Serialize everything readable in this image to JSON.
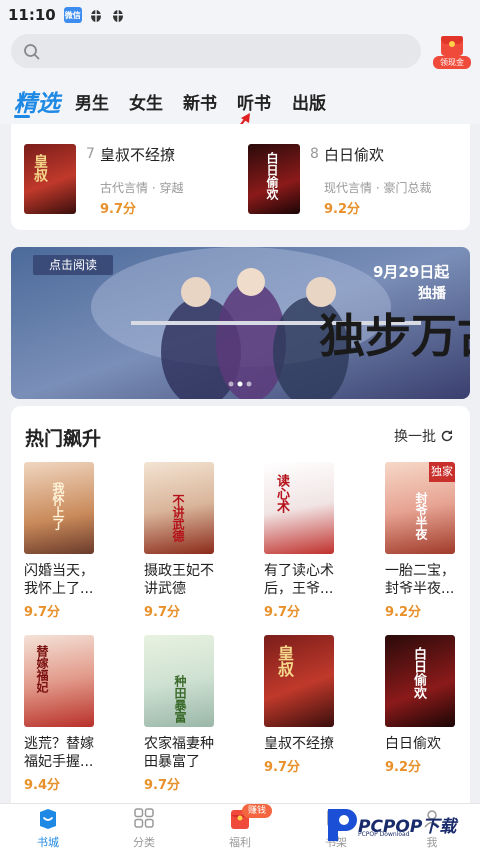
{
  "status_bar": {
    "time": "11:10",
    "app_icon_text": "微信"
  },
  "search": {
    "placeholder": ""
  },
  "redpacket": {
    "label": "领现金"
  },
  "tabs": [
    {
      "label": "精选"
    },
    {
      "label": "男生"
    },
    {
      "label": "女生"
    },
    {
      "label": "新书"
    },
    {
      "label": "听书"
    },
    {
      "label": "出版"
    }
  ],
  "ranking": [
    {
      "num": "7",
      "title": "皇叔不经撩",
      "tags": "古代言情 · 穿越",
      "score": "9.7分",
      "cover_text": "皇叔"
    },
    {
      "num": "8",
      "title": "白日偷欢",
      "tags": "现代言情 · 豪门总裁",
      "score": "9.2分",
      "cover_text": "白日偷欢"
    }
  ],
  "banner": {
    "button": "点击阅读",
    "date": "9月29日起",
    "exclusive": "独播",
    "calligraphy": "独步万古"
  },
  "hot": {
    "title": "热门飙升",
    "refresh": "换一批",
    "books": [
      {
        "name": "闪婚当天，我怀上了...",
        "score": "9.7分",
        "cover_text": "我怀上了"
      },
      {
        "name": "摄政王妃不讲武德",
        "score": "9.7分",
        "cover_text": "不讲武德"
      },
      {
        "name": "有了读心术后，王爷...",
        "score": "9.7分",
        "cover_text": "读心术"
      },
      {
        "name": "一胎二宝，封爷半夜...",
        "score": "9.2分",
        "cover_text": "封爷半夜",
        "badge": "独家"
      },
      {
        "name": "逃荒？替嫁福妃手握...",
        "score": "9.4分",
        "cover_text": "替嫁福妃"
      },
      {
        "name": "农家福妻种田暴富了",
        "score": "9.7分",
        "cover_text": "种田暴富"
      },
      {
        "name": "皇叔不经撩",
        "score": "9.7分",
        "cover_text": "皇叔"
      },
      {
        "name": "白日偷欢",
        "score": "9.2分",
        "cover_text": "白日偷欢"
      }
    ]
  },
  "tabbar": [
    {
      "label": "书城"
    },
    {
      "label": "分类"
    },
    {
      "label": "福利",
      "badge": "赚钱"
    },
    {
      "label": "书架"
    },
    {
      "label": "我"
    }
  ],
  "watermark": {
    "text": "PCPOP下载",
    "sub": "PCPOP Download"
  },
  "colors": {
    "accent": "#1e88e5",
    "score": "#e8902a",
    "red": "#f04a3a"
  }
}
